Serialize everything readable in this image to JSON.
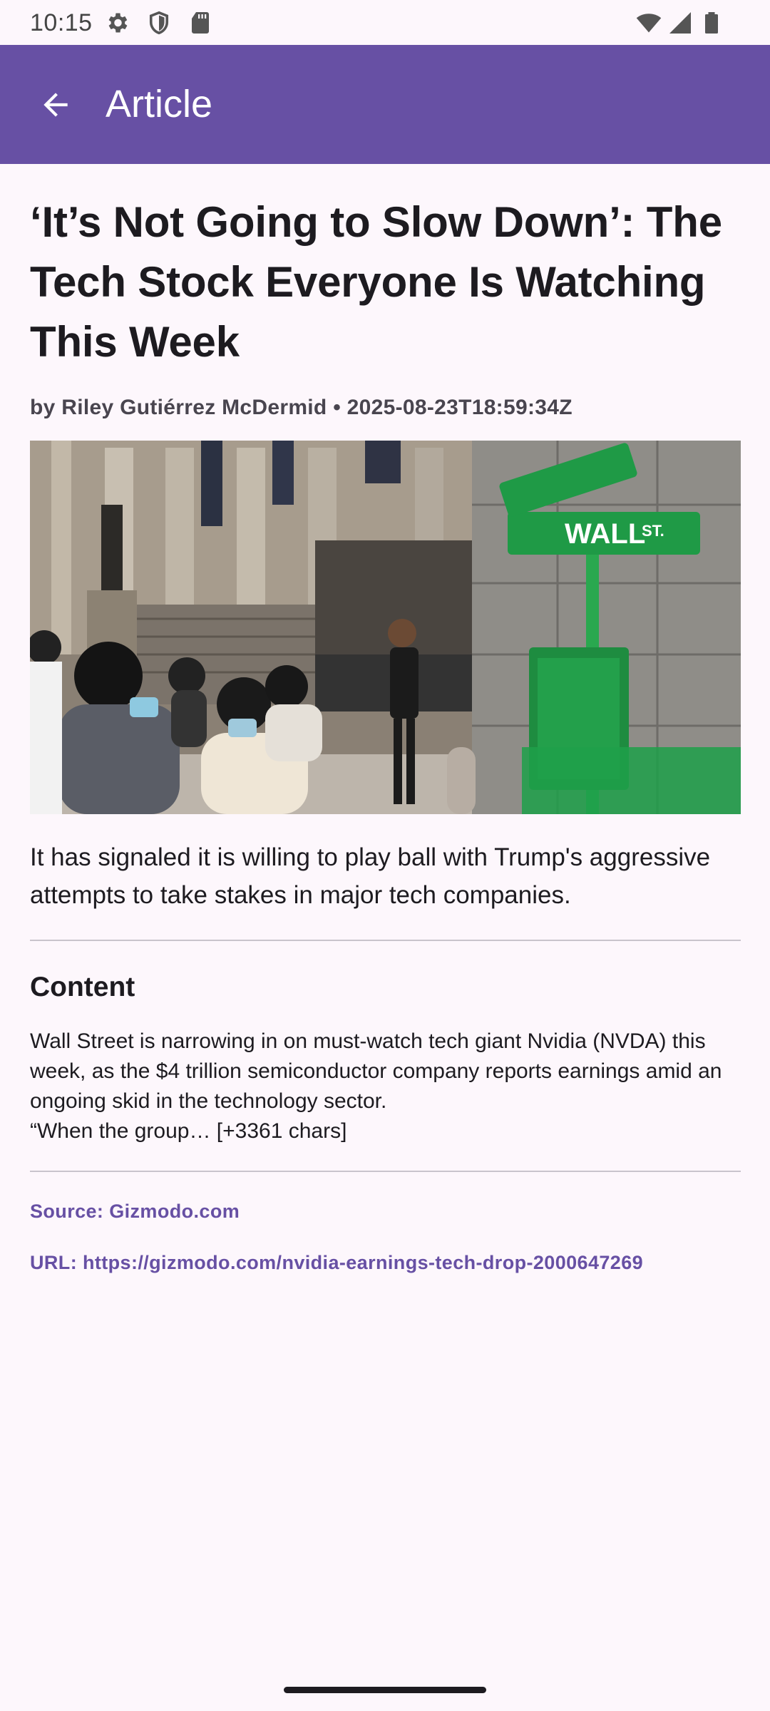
{
  "status_bar": {
    "time": "10:15",
    "icons": [
      "gear-icon",
      "shield-icon",
      "sd-card-icon",
      "wifi-icon",
      "signal-icon",
      "battery-icon"
    ]
  },
  "app_bar": {
    "title": "Article",
    "back_icon": "arrow-back-icon",
    "background_color": "#6750a4"
  },
  "article": {
    "title": "‘It’s Not Going to Slow Down’: The Tech Stock Everyone Is Watching This Week",
    "byline": "by Riley Gutiérrez McDermid • 2025-08-23T18:59:34Z",
    "image_alt": "Wall St. street sign next to a Robinhood sign with people in masks in front of the NYSE building",
    "summary": "It has signaled it is willing to play ball with Trump's aggressive attempts to take stakes in major tech companies.",
    "content_heading": "Content",
    "content_body": "Wall Street is narrowing in on must-watch tech giant Nvidia (NVDA) this week, as the $4 trillion semiconductor company reports earnings amid an ongoing skid in the technology sector.\n“When the group… [+3361 chars]",
    "source": "Source: Gizmodo.com",
    "url": "URL: https://gizmodo.com/nvidia-earnings-tech-drop-2000647269"
  },
  "colors": {
    "accent": "#6750a4",
    "background": "#fdf7fc",
    "text": "#1d1b20"
  }
}
